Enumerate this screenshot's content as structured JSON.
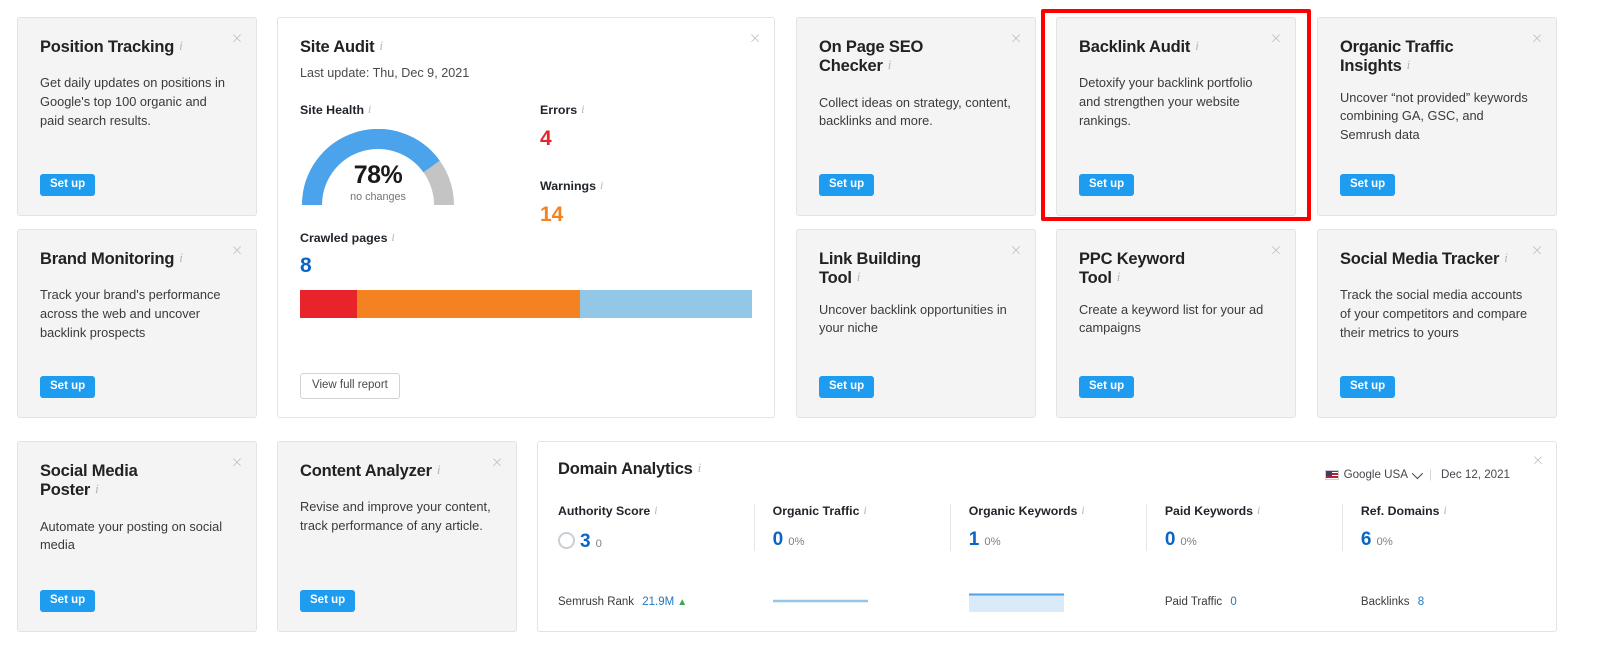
{
  "colors": {
    "accent_blue": "#1d9cf0",
    "link_blue": "#0a66c2",
    "error_red": "#e8232a",
    "warning_orange": "#f58220",
    "highlight_red": "#ff0000",
    "card_grey": "#f4f4f4",
    "gauge_blue": "#4ba3eb",
    "gauge_grey": "#c4c4c4"
  },
  "icons": {
    "info": "info-icon",
    "close": "close-icon",
    "chevron": "chevron-down-icon",
    "flag": "us-flag-icon",
    "arrow_up": "arrow-up-icon"
  },
  "labels": {
    "set_up": "Set up",
    "close": "×",
    "view_full_report": "View full report"
  },
  "cards": [
    {
      "id": "position-tracking",
      "title": "Position Tracking",
      "desc": "Get daily updates on positions in Google's top 100 organic and paid search results.",
      "button": "Set up"
    },
    {
      "id": "brand-monitoring",
      "title": "Brand Monitoring",
      "desc": "Track your brand's performance across the web and uncover backlink prospects",
      "button": "Set up"
    },
    {
      "id": "social-media-poster",
      "title": "Social Media\nPoster",
      "title_line1": "Social Media",
      "title_line2": "Poster",
      "desc": "Automate your posting on social media",
      "button": "Set up"
    },
    {
      "id": "content-analyzer",
      "title": "Content Analyzer",
      "desc": "Revise and improve your content, track performance of any article.",
      "button": "Set up"
    },
    {
      "id": "on-page-seo-checker",
      "title": "On Page SEO Checker",
      "desc": "Collect ideas on strategy, content, backlinks and more.",
      "button": "Set up"
    },
    {
      "id": "backlink-audit",
      "title": "Backlink Audit",
      "desc": "Detoxify your backlink portfolio and strengthen your website rankings.",
      "button": "Set up",
      "highlighted": true
    },
    {
      "id": "organic-traffic-insights",
      "title_line1": "Organic Traffic",
      "title_line2": "Insights",
      "desc": "Uncover “not provided” keywords combining GA, GSC, and Semrush data",
      "button": "Set up"
    },
    {
      "id": "link-building-tool",
      "title_line1": "Link Building",
      "title_line2": "Tool",
      "desc": "Uncover backlink opportunities in your niche",
      "button": "Set up"
    },
    {
      "id": "ppc-keyword-tool",
      "title_line1": "PPC Keyword",
      "title_line2": "Tool",
      "desc": "Create a keyword list for your ad campaigns",
      "button": "Set up"
    },
    {
      "id": "social-media-tracker",
      "title": "Social Media Tracker",
      "desc": "Track the social media accounts of your competitors and compare their metrics to yours",
      "button": "Set up"
    }
  ],
  "site_audit": {
    "title": "Site Audit",
    "last_update": "Last update: Thu, Dec 9, 2021",
    "site_health_label": "Site Health",
    "site_health_value": "78%",
    "site_health_change": "no changes",
    "site_health_percent": 78,
    "errors_label": "Errors",
    "errors_value": "4",
    "warnings_label": "Warnings",
    "warnings_value": "14",
    "crawled_label": "Crawled pages",
    "crawled_value": "8",
    "crawled_segments": [
      {
        "name": "errors",
        "color": "#e8232a",
        "percent": 12.5
      },
      {
        "name": "warnings",
        "color": "#f58220",
        "percent": 49.5
      },
      {
        "name": "notices",
        "color": "#93c7e8",
        "percent": 38
      }
    ],
    "report_button": "View full report"
  },
  "domain_analytics": {
    "title": "Domain Analytics",
    "database": "Google USA",
    "date": "Dec 12, 2021",
    "metrics": [
      {
        "label": "Authority Score",
        "value": "3",
        "delta": "0",
        "has_donut": true,
        "foot_label": "Semrush Rank",
        "foot_value": "21.9M",
        "foot_trend": "up"
      },
      {
        "label": "Organic Traffic",
        "value": "0",
        "delta": "0%",
        "spark": "line"
      },
      {
        "label": "Organic Keywords",
        "value": "1",
        "delta": "0%",
        "spark": "area"
      },
      {
        "label": "Paid Keywords",
        "value": "0",
        "delta": "0%",
        "foot_label": "Paid Traffic",
        "foot_value": "0"
      },
      {
        "label": "Ref. Domains",
        "value": "6",
        "delta": "0%",
        "foot_label": "Backlinks",
        "foot_value": "8"
      }
    ]
  }
}
